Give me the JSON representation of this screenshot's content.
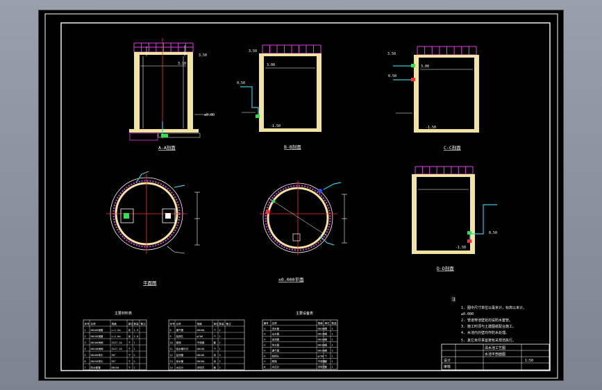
{
  "views": {
    "a": "A-A剖面",
    "b": "B-B剖面",
    "c": "C-C剖面",
    "d": "D-D剖面",
    "plan1": "平面图",
    "plan2": "±0.000平面",
    "scale_label": "1:50"
  },
  "elevations": {
    "a_top": "3.50",
    "a_water": "3.10",
    "a_side": "±0.00",
    "b_top": "3.50",
    "b_water": "3.00",
    "b_low": "0.50",
    "b_bottom": "-1.50",
    "c_top": "3.50",
    "c_water": "3.00",
    "c_pipe": "0.50",
    "c_bottom": "-1.50",
    "d_pipe": "0.50",
    "d_bottom": "-1.50"
  },
  "notes": {
    "title": "注",
    "lines": [
      "1. 图中尺寸单位以毫米计，标高以米计。",
      "   ±0.000",
      "2. 管道穿池壁处均设防水套管。",
      "3. 施工时须与土建图纸配合施工。",
      "4. 水池内外壁均作防水处理。",
      "5. 其它未尽事宜按有关规范执行。"
    ]
  },
  "tables": {
    "left_title": "主要材料表",
    "right_title": "主要设备表",
    "left_headers": [
      "序号",
      "名称",
      "规格",
      "单位",
      "数量",
      "备注"
    ],
    "right_headers": [
      "编号",
      "名称",
      "规格",
      "单位",
      "数量"
    ],
    "left_rows": [
      [
        "1",
        "DN100钢管",
        "L=1.5m",
        "米",
        "1.5",
        ""
      ],
      [
        "2",
        "DN150钢管",
        "L=2.0m",
        "米",
        "2.0",
        ""
      ],
      [
        "3",
        "DN100闸阀",
        "Z41T-10",
        "个",
        "1",
        ""
      ],
      [
        "4",
        "DN150闸阀",
        "Z41T-10",
        "个",
        "1",
        ""
      ],
      [
        "5",
        "DN100弯头",
        "90°",
        "个",
        "2",
        ""
      ],
      [
        "6",
        "DN150弯头",
        "90°",
        "个",
        "2",
        ""
      ],
      [
        "7",
        "防水套管",
        "DN150",
        "个",
        "2",
        ""
      ]
    ],
    "mid_rows": [
      [
        "8",
        "通气管",
        "DN100",
        "个",
        "2",
        ""
      ],
      [
        "9",
        "检修孔",
        "φ700",
        "个",
        "1",
        ""
      ],
      [
        "10",
        "爬梯",
        "不锈钢",
        "套",
        "1",
        ""
      ],
      [
        "11",
        "吸水喇叭口",
        "DN150",
        "个",
        "1",
        ""
      ],
      [
        "12",
        "溢流管",
        "DN100",
        "米",
        "3",
        ""
      ],
      [
        "13",
        "泄水管",
        "DN100",
        "米",
        "2",
        ""
      ],
      [
        "14",
        "水位计",
        "浮球式",
        "套",
        "1",
        ""
      ]
    ],
    "right_rows": [
      [
        "①",
        "进水管",
        "DN100",
        "根",
        "1"
      ],
      [
        "②",
        "出水管",
        "DN150",
        "根",
        "1"
      ],
      [
        "③",
        "溢流管",
        "DN100",
        "根",
        "1"
      ],
      [
        "④",
        "泄水管",
        "DN100",
        "根",
        "1"
      ],
      [
        "⑤",
        "通气管",
        "DN100",
        "根",
        "2"
      ],
      [
        "⑥",
        "检修孔",
        "φ700",
        "个",
        "1"
      ],
      [
        "⑦",
        "爬梯",
        "不锈钢",
        "套",
        "1"
      ],
      [
        "⑧",
        "水位计",
        "浮球式",
        "套",
        "1"
      ]
    ]
  },
  "title_block": {
    "project": "清水池工艺图",
    "drawing": "水池平剖面图",
    "row3": "设计",
    "row4": "审核"
  },
  "colors": {
    "sheet_bg": "#000000",
    "frame": "#ffffff",
    "wall": "#f3e3a0",
    "handrail": "#e040e0",
    "pipe": "#35c8d8",
    "axis": "#ff3030",
    "text": "#ffffff",
    "hatch": "#e040e0",
    "green": "#30e050",
    "blue": "#3050ff"
  }
}
